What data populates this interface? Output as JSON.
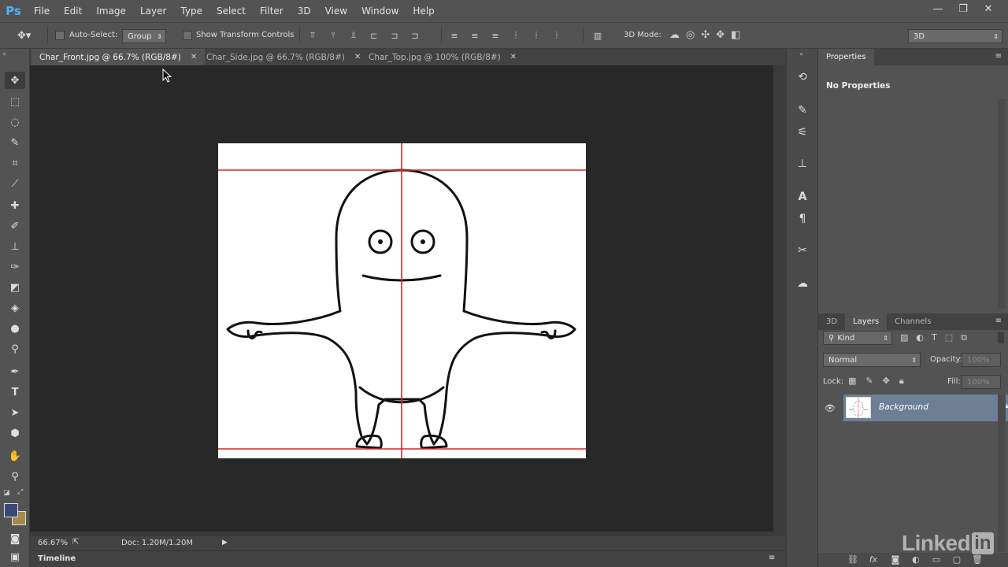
{
  "app": {
    "logo": "Ps"
  },
  "menu": [
    "File",
    "Edit",
    "Image",
    "Layer",
    "Type",
    "Select",
    "Filter",
    "3D",
    "View",
    "Window",
    "Help"
  ],
  "window_controls": {
    "minimize": "—",
    "restore": "❐",
    "close": "✕"
  },
  "options_bar": {
    "auto_select_label": "Auto-Select:",
    "auto_select_value": "Group",
    "show_transform_label": "Show Transform Controls",
    "mode_label": "3D Mode:",
    "workspace_value": "3D"
  },
  "tabs": [
    {
      "label": "Char_Front.jpg @ 66.7% (RGB/8#)",
      "active": true
    },
    {
      "label": "Char_Side.jpg @ 66.7% (RGB/8#)",
      "active": false
    },
    {
      "label": "Char_Top.jpg @ 100% (RGB/8#)",
      "active": false
    }
  ],
  "status": {
    "zoom": "66.67%",
    "doc_info": "Doc: 1.20M/1.20M"
  },
  "timeline": {
    "label": "Timeline"
  },
  "properties": {
    "title": "Properties",
    "message": "No Properties"
  },
  "layers_panel": {
    "tabs": [
      "3D",
      "Layers",
      "Channels"
    ],
    "active_tab": "Layers",
    "filter_kind": "Kind",
    "blend_mode": "Normal",
    "opacity_label": "Opacity:",
    "opacity_value": "100%",
    "lock_label": "Lock:",
    "fill_label": "Fill:",
    "fill_value": "100%",
    "layers": [
      {
        "name": "Background",
        "visible": true,
        "locked": true,
        "selected": true
      }
    ]
  },
  "watermark": "Linked",
  "watermark_in": "in",
  "colors": {
    "ui_bg": "#535353",
    "canvas_bg": "#282828",
    "guide": "#cc2a2a",
    "layer_selected": "#6d7f95"
  }
}
